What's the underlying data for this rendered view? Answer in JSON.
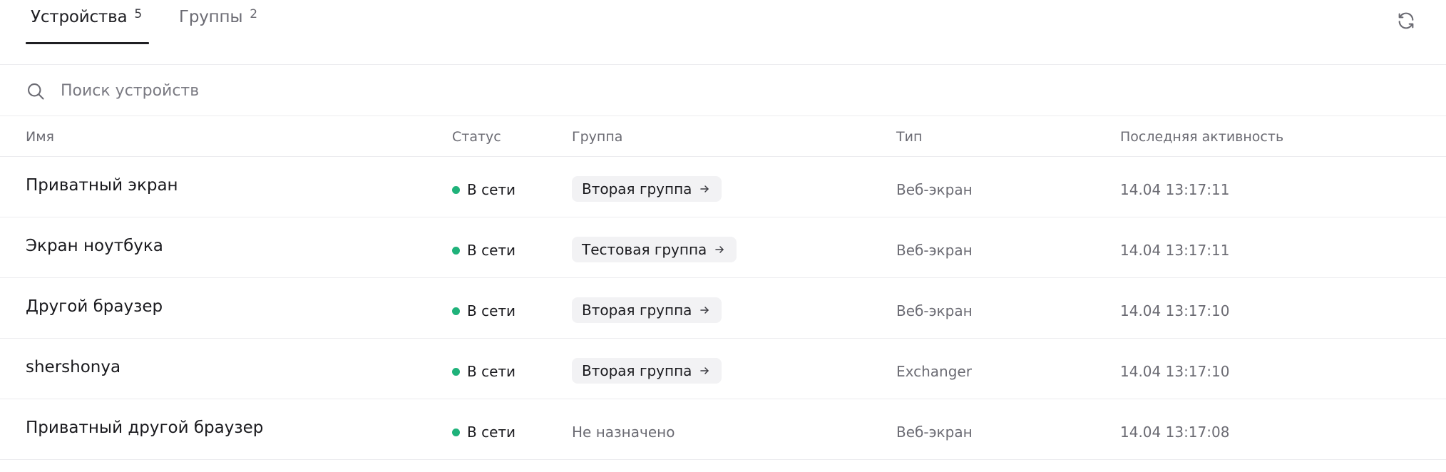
{
  "tabs": [
    {
      "label": "Устройства",
      "count": "5",
      "active": true
    },
    {
      "label": "Группы",
      "count": "2",
      "active": false
    }
  ],
  "toolbar": {
    "refresh_icon": "refresh-icon"
  },
  "search": {
    "placeholder": "Поиск устройств",
    "value": "",
    "icon": "search-icon"
  },
  "table": {
    "columns": [
      "Имя",
      "Статус",
      "Группа",
      "Тип",
      "Последняя активность"
    ],
    "rows": [
      {
        "name": "Приватный экран",
        "status": "В сети",
        "group": "Вторая группа",
        "type": "Веб-экран",
        "activity": "14.04 13:17:11"
      },
      {
        "name": "Экран ноутбука",
        "status": "В сети",
        "group": "Тестовая группа",
        "type": "Веб-экран",
        "activity": "14.04 13:17:11"
      },
      {
        "name": "Другой браузер",
        "status": "В сети",
        "group": "Вторая группа",
        "type": "Веб-экран",
        "activity": "14.04 13:17:10"
      },
      {
        "name": "shershonya",
        "status": "В сети",
        "group": "Вторая группа",
        "type": "Exchanger",
        "activity": "14.04 13:17:10"
      },
      {
        "name": "Приватный другой браузер",
        "status": "В сети",
        "group": "Не назначено",
        "group_assigned": false,
        "type": "Веб-экран",
        "activity": "14.04 13:17:08"
      }
    ]
  },
  "colors": {
    "status_online": "#1fb27a",
    "text_primary": "#1a1a1e",
    "text_secondary": "#6b6b73",
    "chip_bg": "#f2f2f4",
    "divider": "#ececef"
  }
}
